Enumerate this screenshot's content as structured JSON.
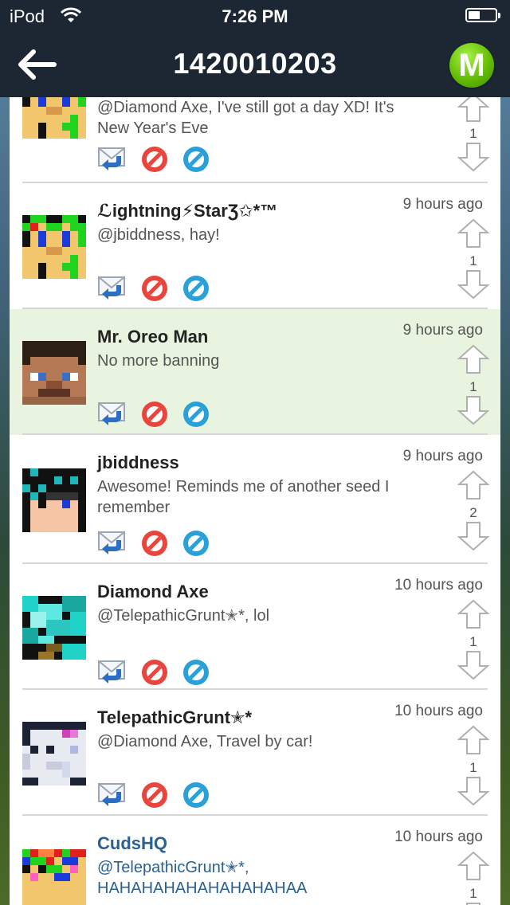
{
  "status": {
    "carrier": "iPod",
    "time": "7:26 PM"
  },
  "nav": {
    "title": "1420010203",
    "logo_letter": "M"
  },
  "posts": [
    {
      "name": "",
      "time": "",
      "message": "@Diamond Axe, I've still got a day XD! It's New Year's Eve",
      "votes": "1",
      "avatar": "green-blue-pixel-avatar"
    },
    {
      "name": "ℒightning⚡StarƷ✩*™",
      "time": "9 hours ago",
      "message": "@jbiddness, hay!",
      "votes": "1",
      "avatar": "green-blue-pixel-avatar"
    },
    {
      "name": "Mr. Oreo Man",
      "time": "9 hours ago",
      "message": "No more banning",
      "votes": "1",
      "avatar": "steve-pixel-avatar"
    },
    {
      "name": "jbiddness",
      "time": "9 hours ago",
      "message": "Awesome! Reminds me of another seed I remember",
      "votes": "2",
      "avatar": "dark-hair-pixel-avatar"
    },
    {
      "name": "Diamond Axe",
      "time": "10 hours ago",
      "message": "@TelepathicGrunt✭*, lol",
      "votes": "1",
      "avatar": "diamond-axe-pixel-avatar"
    },
    {
      "name": "TelepathicGrunt✭*",
      "time": "10 hours ago",
      "message": "@Diamond Axe, Travel by car!",
      "votes": "1",
      "avatar": "white-mask-pixel-avatar"
    },
    {
      "name": "CudsHQ",
      "time": "10 hours ago",
      "message": "@TelepathicGrunt✭*, HAHAHAHAHAHAHAHAHAA",
      "votes": "1",
      "avatar": "colorful-pixel-avatar"
    }
  ],
  "colors": {
    "bar": "#1c2733",
    "highlight": "#e9f4e0",
    "ban_red": "#e8463d",
    "blue_action": "#2aa0d8",
    "link_blue": "#2a6193"
  }
}
